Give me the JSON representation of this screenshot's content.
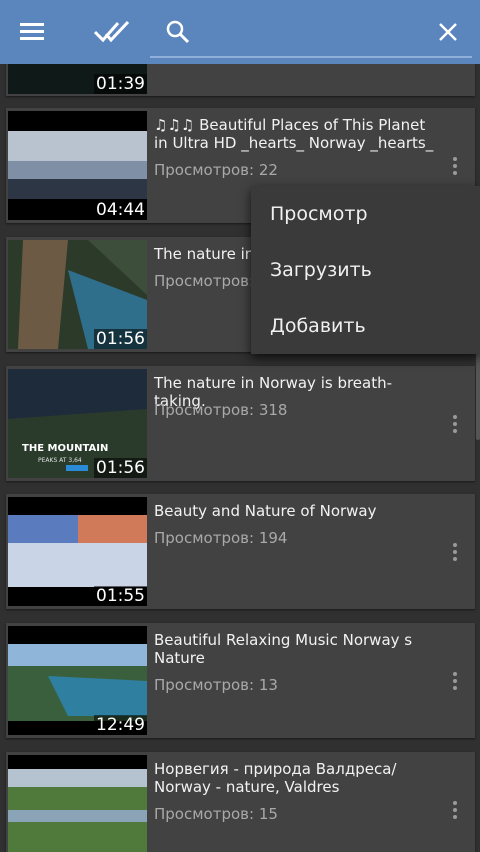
{
  "toolbar": {
    "menu_icon": "hamburger-icon",
    "select_icon": "double-check-icon",
    "search_icon": "search-icon",
    "close_icon": "close-icon"
  },
  "videos": [
    {
      "title": "",
      "views_label": "",
      "views": "",
      "duration": "01:39"
    },
    {
      "title": "♫♫♫ Beautiful Places of This Planet in Ultra HD _hearts_ Norway _hearts_",
      "views_label": "Просмотров",
      "views": "22",
      "duration": "04:44"
    },
    {
      "title": "The nature in N",
      "views_label": "Просмотров",
      "views": "",
      "duration": "01:56"
    },
    {
      "title": "The nature in Norway is breath-taking.",
      "views_label": "Просмотров",
      "views": "318",
      "duration": "01:56"
    },
    {
      "title": "Beauty and Nature of Norway",
      "views_label": "Просмотров",
      "views": "194",
      "duration": "01:55"
    },
    {
      "title": "Beautiful Relaxing Music  Norway s Nature",
      "views_label": "Просмотров",
      "views": "13",
      "duration": "12:49"
    },
    {
      "title": "Норвегия - природа Валдреса/ Norway - nature, Valdres",
      "views_label": "Просмотров",
      "views": "15",
      "duration": ""
    }
  ],
  "thumb_overlays": {
    "mountain_title": "THE MOUNTAIN",
    "mountain_sub": "PEAKS AT 3,64"
  },
  "context_menu": {
    "items": [
      "Просмотр",
      "Загрузить",
      "Добавить"
    ]
  }
}
